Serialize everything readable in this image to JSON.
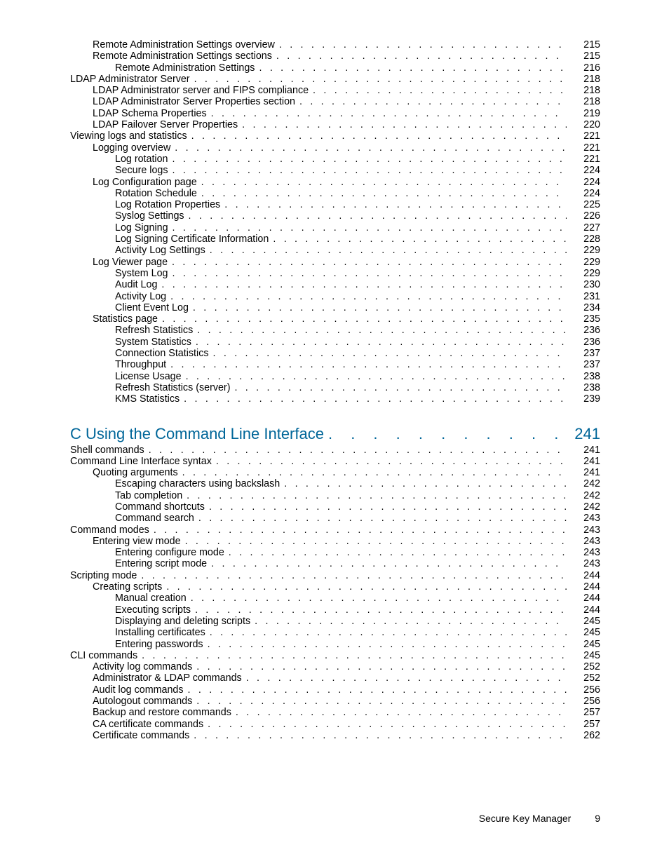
{
  "toc": [
    {
      "level": 2,
      "title": "Remote Administration Settings overview",
      "page": 215
    },
    {
      "level": 2,
      "title": "Remote Administration Settings sections",
      "page": 215
    },
    {
      "level": 3,
      "title": "Remote Administration Settings",
      "page": 216
    },
    {
      "level": 1,
      "title": "LDAP Administrator Server",
      "page": 218
    },
    {
      "level": 2,
      "title": "LDAP Administrator server and FIPS compliance",
      "page": 218
    },
    {
      "level": 2,
      "title": "LDAP Administrator Server Properties section",
      "page": 218
    },
    {
      "level": 2,
      "title": "LDAP Schema Properties",
      "page": 219
    },
    {
      "level": 2,
      "title": "LDAP Failover Server Properties",
      "page": 220
    },
    {
      "level": 1,
      "title": "Viewing logs and statistics",
      "page": 221
    },
    {
      "level": 2,
      "title": "Logging overview",
      "page": 221
    },
    {
      "level": 3,
      "title": "Log rotation",
      "page": 221
    },
    {
      "level": 3,
      "title": "Secure logs",
      "page": 224
    },
    {
      "level": 2,
      "title": "Log Configuration page",
      "page": 224
    },
    {
      "level": 3,
      "title": "Rotation Schedule",
      "page": 224
    },
    {
      "level": 3,
      "title": "Log Rotation Properties",
      "page": 225
    },
    {
      "level": 3,
      "title": "Syslog Settings",
      "page": 226
    },
    {
      "level": 3,
      "title": "Log Signing",
      "page": 227
    },
    {
      "level": 3,
      "title": "Log Signing Certificate Information",
      "page": 228
    },
    {
      "level": 3,
      "title": "Activity Log Settings",
      "page": 229
    },
    {
      "level": 2,
      "title": "Log Viewer page",
      "page": 229
    },
    {
      "level": 3,
      "title": "System Log",
      "page": 229
    },
    {
      "level": 3,
      "title": "Audit Log",
      "page": 230
    },
    {
      "level": 3,
      "title": "Activity Log",
      "page": 231
    },
    {
      "level": 3,
      "title": "Client Event Log",
      "page": 234
    },
    {
      "level": 2,
      "title": "Statistics page",
      "page": 235
    },
    {
      "level": 3,
      "title": "Refresh Statistics",
      "page": 236
    },
    {
      "level": 3,
      "title": "System Statistics",
      "page": 236
    },
    {
      "level": 3,
      "title": "Connection Statistics",
      "page": 237
    },
    {
      "level": 3,
      "title": "Throughput",
      "page": 237
    },
    {
      "level": 3,
      "title": "License Usage",
      "page": 238
    },
    {
      "level": 3,
      "title": "Refresh Statistics (server)",
      "page": 238
    },
    {
      "level": 3,
      "title": "KMS Statistics",
      "page": 239
    }
  ],
  "chapter": {
    "title": "C Using the Command Line Interface",
    "page": 241
  },
  "toc2": [
    {
      "level": 1,
      "title": "Shell commands",
      "page": 241
    },
    {
      "level": 1,
      "title": "Command Line Interface syntax",
      "page": 241
    },
    {
      "level": 2,
      "title": "Quoting arguments",
      "page": 241
    },
    {
      "level": 3,
      "title": "Escaping characters using backslash",
      "page": 242
    },
    {
      "level": 3,
      "title": "Tab completion",
      "page": 242
    },
    {
      "level": 3,
      "title": "Command shortcuts",
      "page": 242
    },
    {
      "level": 3,
      "title": "Command search",
      "page": 243
    },
    {
      "level": 1,
      "title": "Command modes",
      "page": 243
    },
    {
      "level": 2,
      "title": "Entering view mode",
      "page": 243
    },
    {
      "level": 3,
      "title": "Entering configure mode",
      "page": 243
    },
    {
      "level": 3,
      "title": "Entering script mode",
      "page": 243
    },
    {
      "level": 1,
      "title": "Scripting mode",
      "page": 244
    },
    {
      "level": 2,
      "title": "Creating scripts",
      "page": 244
    },
    {
      "level": 3,
      "title": "Manual creation",
      "page": 244
    },
    {
      "level": 3,
      "title": "Executing scripts",
      "page": 244
    },
    {
      "level": 3,
      "title": "Displaying and deleting scripts",
      "page": 245
    },
    {
      "level": 3,
      "title": "Installing certificates",
      "page": 245
    },
    {
      "level": 3,
      "title": "Entering passwords",
      "page": 245
    },
    {
      "level": 1,
      "title": "CLI commands",
      "page": 245
    },
    {
      "level": 2,
      "title": "Activity log commands",
      "page": 252
    },
    {
      "level": 2,
      "title": "Administrator & LDAP commands",
      "page": 252
    },
    {
      "level": 2,
      "title": "Audit log commands",
      "page": 256
    },
    {
      "level": 2,
      "title": "Autologout commands",
      "page": 256
    },
    {
      "level": 2,
      "title": "Backup and restore commands",
      "page": 257
    },
    {
      "level": 2,
      "title": "CA certificate commands",
      "page": 257
    },
    {
      "level": 2,
      "title": "Certificate commands",
      "page": 262
    }
  ],
  "footer": {
    "title": "Secure Key Manager",
    "page": "9"
  }
}
